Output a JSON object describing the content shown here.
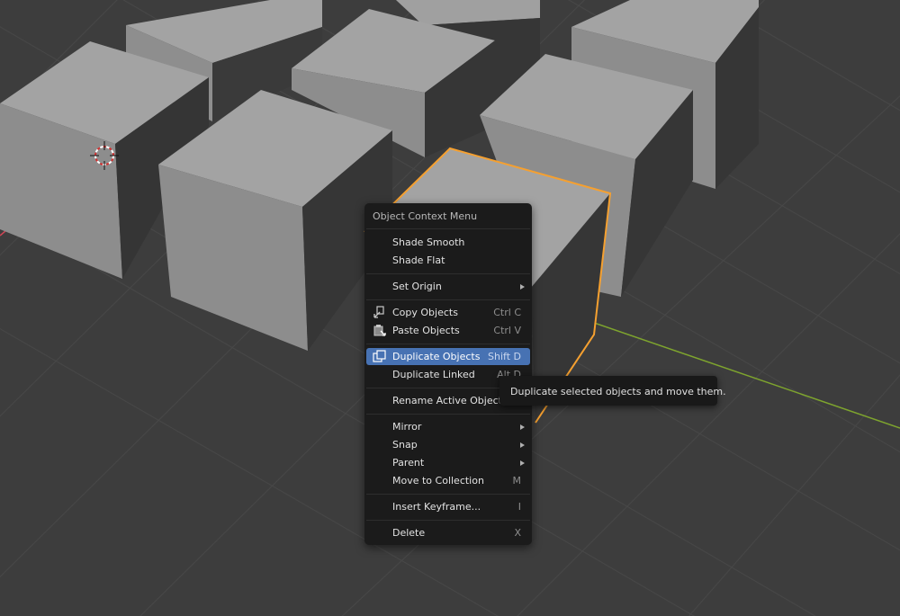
{
  "colors": {
    "background": "#3d3d3d",
    "cube_top": "#9d9d9d",
    "cube_front": "#8a8a8a",
    "cube_side": "#363636",
    "selection_outline": "#f5a030",
    "x_axis": "#d04555",
    "y_axis": "#7ea42e",
    "menu_bg": "#1b1b1b",
    "menu_highlight": "#4772b3"
  },
  "viewport": {
    "cursor_icon": "3d-cursor-icon"
  },
  "context_menu": {
    "title": "Object Context Menu",
    "items": [
      {
        "label": "Shade Smooth",
        "shortcut": ""
      },
      {
        "label": "Shade Flat",
        "shortcut": ""
      },
      {
        "label": "Set Origin",
        "shortcut": ""
      },
      {
        "label": "Copy Objects",
        "shortcut": "Ctrl C",
        "icon": "copy-icon"
      },
      {
        "label": "Paste Objects",
        "shortcut": "Ctrl V",
        "icon": "paste-icon"
      },
      {
        "label": "Duplicate Objects",
        "shortcut": "Shift D",
        "icon": "duplicate-icon"
      },
      {
        "label": "Duplicate Linked",
        "shortcut": "Alt D"
      },
      {
        "label": "Rename Active Object...",
        "shortcut": ""
      },
      {
        "label": "Mirror",
        "shortcut": ""
      },
      {
        "label": "Snap",
        "shortcut": ""
      },
      {
        "label": "Parent",
        "shortcut": ""
      },
      {
        "label": "Move to Collection",
        "shortcut": "M"
      },
      {
        "label": "Insert Keyframe...",
        "shortcut": "I"
      },
      {
        "label": "Delete",
        "shortcut": "X"
      }
    ]
  },
  "tooltip": {
    "text": "Duplicate selected objects and move them."
  }
}
